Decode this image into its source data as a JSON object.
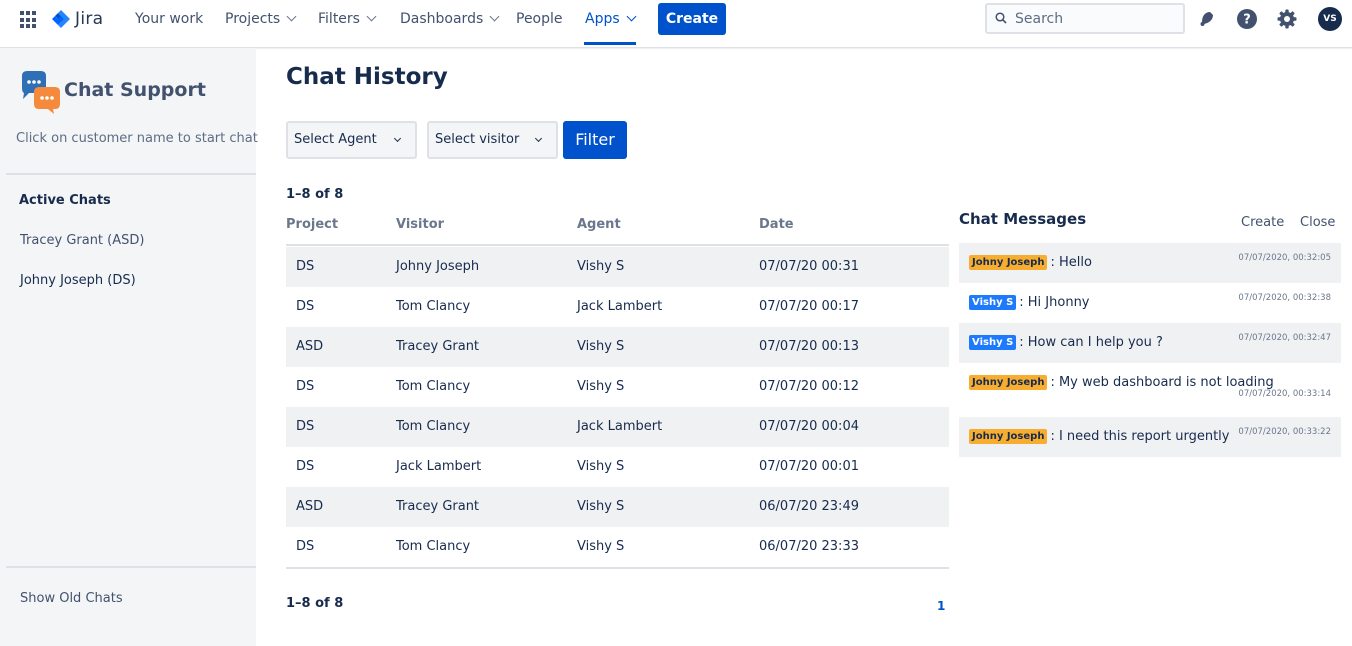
{
  "nav": {
    "product": "Jira",
    "items": [
      {
        "label": "Your work",
        "dropdown": false
      },
      {
        "label": "Projects",
        "dropdown": true
      },
      {
        "label": "Filters",
        "dropdown": true
      },
      {
        "label": "Dashboards",
        "dropdown": true
      },
      {
        "label": "People",
        "dropdown": false
      },
      {
        "label": "Apps",
        "dropdown": true,
        "active": true
      }
    ],
    "create_label": "Create",
    "search_placeholder": "Search",
    "icons": [
      "apps-grid-icon",
      "jira-logo-icon",
      "search-icon",
      "notification-icon",
      "help-icon",
      "settings-icon"
    ],
    "avatar_initials": "VS",
    "accent_color": "#0052cc"
  },
  "sidebar": {
    "title": "Chat Support",
    "subtitle": "Click on customer name to start chat",
    "active_heading": "Active Chats",
    "active_chats": [
      {
        "label": "Tracey Grant (ASD)",
        "muted": true
      },
      {
        "label": "Johny Joseph (DS)",
        "muted": false
      }
    ],
    "footer_link": "Show Old Chats"
  },
  "main": {
    "title": "Chat History",
    "select_agent": "Select Agent",
    "select_visitor": "Select visitor",
    "filter_label": "Filter",
    "count_top": "1–8 of 8",
    "count_bottom": "1–8 of 8",
    "page": "1",
    "columns": [
      "Project",
      "Visitor",
      "Agent",
      "Date"
    ],
    "rows": [
      [
        "DS",
        "Johny Joseph",
        "Vishy S",
        "07/07/20 00:31"
      ],
      [
        "DS",
        "Tom Clancy",
        "Jack Lambert",
        "07/07/20 00:17"
      ],
      [
        "ASD",
        "Tracey Grant",
        "Vishy S",
        "07/07/20 00:13"
      ],
      [
        "DS",
        "Tom Clancy",
        "Vishy S",
        "07/07/20 00:12"
      ],
      [
        "DS",
        "Tom Clancy",
        "Jack Lambert",
        "07/07/20 00:04"
      ],
      [
        "DS",
        "Jack Lambert",
        "Vishy S",
        "07/07/20 00:01"
      ],
      [
        "ASD",
        "Tracey Grant",
        "Vishy S",
        "06/07/20 23:49"
      ],
      [
        "DS",
        "Tom Clancy",
        "Vishy S",
        "06/07/20 23:33"
      ]
    ]
  },
  "chat": {
    "title": "Chat Messages",
    "create_label": "Create",
    "close_label": "Close",
    "messages": [
      {
        "sender": "Johny Joseph",
        "role": "visitor",
        "text": ": Hello",
        "time": "07/07/2020, 00:32:05"
      },
      {
        "sender": "Vishy S",
        "role": "agent",
        "text": ": Hi Jhonny",
        "time": "07/07/2020, 00:32:38"
      },
      {
        "sender": "Vishy S",
        "role": "agent",
        "text": ": How can I help you ?",
        "time": "07/07/2020, 00:32:47"
      },
      {
        "sender": "Johny Joseph",
        "role": "visitor",
        "text": ": My web dashboard is not loading",
        "time": "07/07/2020, 00:33:14"
      },
      {
        "sender": "Johny Joseph",
        "role": "visitor",
        "text": ": I need this report urgently",
        "time": "07/07/2020, 00:33:22"
      }
    ],
    "visitor_color": "#f6ad30",
    "agent_color": "#1d7afc"
  }
}
